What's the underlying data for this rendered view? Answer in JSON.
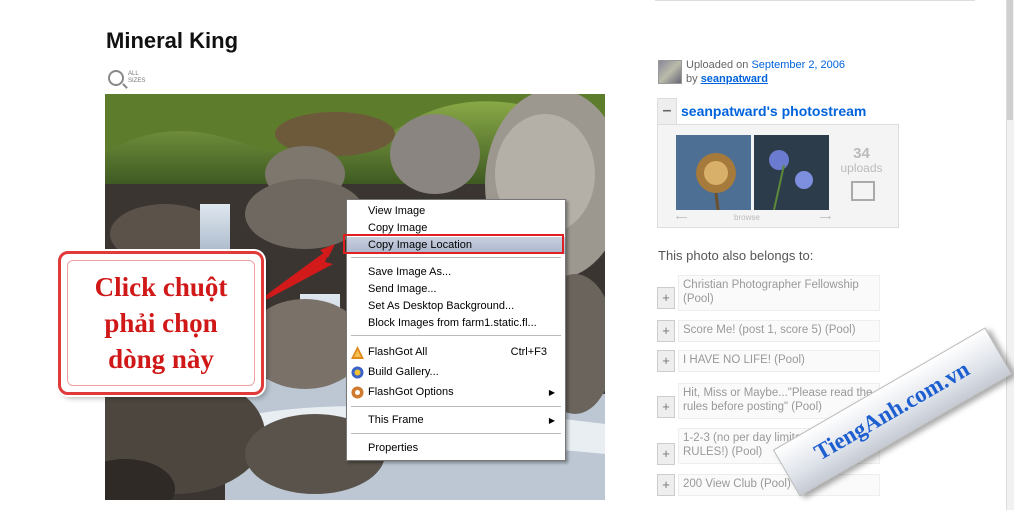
{
  "page": {
    "title": "Mineral King",
    "all_sizes_line1": "ALL",
    "all_sizes_line2": "SIZES"
  },
  "uploaded": {
    "prefix": "Uploaded on",
    "date": "September 2, 2006",
    "by": "by",
    "user": "seanpatward"
  },
  "photostream": {
    "collapse_symbol": "–",
    "title": "seanpatward's photostream",
    "count": "34",
    "count_label": "uploads",
    "browse": "browse",
    "prev": "⟵",
    "next": "⟶"
  },
  "belongs": {
    "heading": "This photo also belongs to:",
    "pools": [
      {
        "name": "Christian Photographer Fellowship (Pool)"
      },
      {
        "name": "Score Me! (post 1, score 5) (Pool)"
      },
      {
        "name": "I HAVE NO LIFE! (Pool)"
      },
      {
        "name": "Hit, Miss or Maybe...\"Please read the rules before posting\" (Pool)"
      },
      {
        "name": "1-2-3 (no per day limitation) (READ RULES!) (Pool)"
      },
      {
        "name": "200 View Club (Pool)"
      }
    ]
  },
  "context_menu": {
    "items": [
      {
        "label": "View Image"
      },
      {
        "label": "Copy Image"
      },
      {
        "label": "Copy Image Location"
      },
      {
        "label": "Save Image As..."
      },
      {
        "label": "Send Image..."
      },
      {
        "label": "Set As Desktop Background..."
      },
      {
        "label": "Block Images from farm1.static.fl..."
      },
      {
        "label": "FlashGot All",
        "shortcut": "Ctrl+F3"
      },
      {
        "label": "Build Gallery..."
      },
      {
        "label": "FlashGot Options"
      },
      {
        "label": "This Frame"
      },
      {
        "label": "Properties"
      }
    ],
    "submenu_arrow": "▶"
  },
  "callout": {
    "line1": "Click chuột",
    "line2": "phải chọn",
    "line3": "dòng này"
  },
  "watermark": {
    "text": "TiengAnh.com.vn"
  },
  "colors": {
    "link": "#0063dc",
    "callout_red": "#d01818",
    "watermark_blue": "#1d5fd0"
  }
}
